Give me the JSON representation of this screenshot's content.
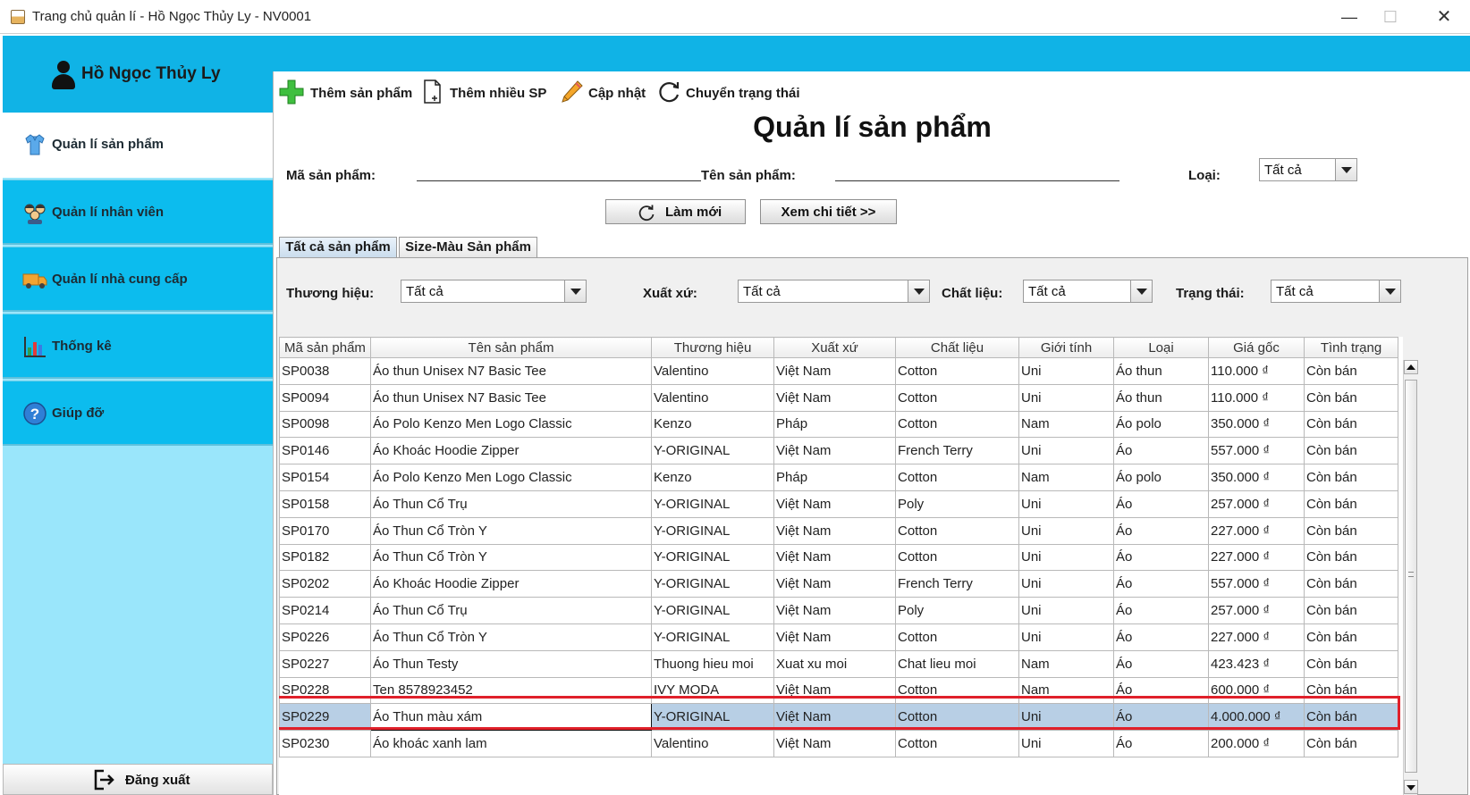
{
  "window": {
    "title": "Trang chủ quản lí - Hồ Ngọc Thủy Ly - NV0001",
    "minimize": "—",
    "maximize": "☐",
    "close": "✕"
  },
  "sidebar": {
    "user_name": "Hồ Ngọc Thủy Ly",
    "items": [
      {
        "label": "Quản lí sản phẩm",
        "icon": "shirt-icon",
        "active": true
      },
      {
        "label": "Quản lí nhân viên",
        "icon": "staff-icon",
        "active": false
      },
      {
        "label": "Quản lí nhà cung cấp",
        "icon": "truck-icon",
        "active": false
      },
      {
        "label": "Thống kê",
        "icon": "bar-chart-icon",
        "active": false
      },
      {
        "label": "Giúp đỡ",
        "icon": "help-icon",
        "active": false
      }
    ],
    "logout_label": "Đăng xuất"
  },
  "toolbar": {
    "add": "Thêm sản phẩm",
    "add_many": "Thêm nhiều SP",
    "update": "Cập nhật",
    "change_status": "Chuyển trạng thái"
  },
  "page_title": "Quản lí sản phẩm",
  "search": {
    "code_label": "Mã sản phẩm:",
    "code_value": "",
    "name_label": "Tên sản phẩm:",
    "name_value": "",
    "type_label": "Loại:",
    "type_value": "Tất cả"
  },
  "buttons": {
    "refresh": "Làm mới",
    "detail": "Xem chi tiết >>"
  },
  "tabs": [
    {
      "label": "Tất cả sản phẩm",
      "active": true
    },
    {
      "label": "Size-Màu Sản phẩm",
      "active": false
    }
  ],
  "filters": {
    "brand_label": "Thương hiệu:",
    "brand_value": "Tất cả",
    "origin_label": "Xuất xứ:",
    "origin_value": "Tất cả",
    "material_label": "Chất liệu:",
    "material_value": "Tất cả",
    "status_label": "Trạng thái:",
    "status_value": "Tất cả"
  },
  "table": {
    "columns": [
      "Mã sản phẩm",
      "Tên sản phẩm",
      "Thương hiệu",
      "Xuất xứ",
      "Chất liệu",
      "Giới tính",
      "Loại",
      "Giá gốc",
      "Tình trạng"
    ],
    "rows": [
      [
        "SP0038",
        "Áo thun Unisex N7 Basic Tee",
        "Valentino",
        "Việt Nam",
        "Cotton",
        "Uni",
        "Áo thun",
        "110.000 ₫",
        "Còn bán"
      ],
      [
        "SP0094",
        "Áo thun Unisex N7 Basic Tee",
        "Valentino",
        "Việt Nam",
        "Cotton",
        "Uni",
        "Áo thun",
        "110.000 ₫",
        "Còn bán"
      ],
      [
        "SP0098",
        "Áo Polo Kenzo Men Logo Classic",
        "Kenzo",
        "Pháp",
        "Cotton",
        "Nam",
        "Áo polo",
        "350.000 ₫",
        "Còn bán"
      ],
      [
        "SP0146",
        "Áo Khoác Hoodie Zipper",
        "Y-ORIGINAL",
        "Việt Nam",
        "French Terry",
        "Uni",
        "Áo",
        "557.000 ₫",
        "Còn bán"
      ],
      [
        "SP0154",
        "Áo Polo Kenzo Men Logo Classic",
        "Kenzo",
        "Pháp",
        "Cotton",
        "Nam",
        "Áo polo",
        "350.000 ₫",
        "Còn bán"
      ],
      [
        "SP0158",
        "Áo Thun Cổ Trụ",
        "Y-ORIGINAL",
        "Việt Nam",
        "Poly",
        "Uni",
        "Áo",
        "257.000 ₫",
        "Còn bán"
      ],
      [
        "SP0170",
        "Áo Thun Cổ Tròn Y",
        "Y-ORIGINAL",
        "Việt Nam",
        "Cotton",
        "Uni",
        "Áo",
        "227.000 ₫",
        "Còn bán"
      ],
      [
        "SP0182",
        "Áo Thun Cổ Tròn Y",
        "Y-ORIGINAL",
        "Việt Nam",
        "Cotton",
        "Uni",
        "Áo",
        "227.000 ₫",
        "Còn bán"
      ],
      [
        "SP0202",
        "Áo Khoác Hoodie Zipper",
        "Y-ORIGINAL",
        "Việt Nam",
        "French Terry",
        "Uni",
        "Áo",
        "557.000 ₫",
        "Còn bán"
      ],
      [
        "SP0214",
        "Áo Thun Cổ Trụ",
        "Y-ORIGINAL",
        "Việt Nam",
        "Poly",
        "Uni",
        "Áo",
        "257.000 ₫",
        "Còn bán"
      ],
      [
        "SP0226",
        "Áo Thun Cổ Tròn Y",
        "Y-ORIGINAL",
        "Việt Nam",
        "Cotton",
        "Uni",
        "Áo",
        "227.000 ₫",
        "Còn bán"
      ],
      [
        "SP0227",
        "Áo Thun Testy",
        "Thuong hieu moi",
        "Xuat xu moi",
        "Chat lieu moi",
        "Nam",
        "Áo",
        "423.423 ₫",
        "Còn bán"
      ],
      [
        "SP0228",
        "Ten 8578923452",
        "IVY MODA",
        "Việt Nam",
        "Cotton",
        "Nam",
        "Áo",
        "600.000 ₫",
        "Còn bán"
      ],
      [
        "SP0229",
        "Áo Thun màu xám",
        "Y-ORIGINAL",
        "Việt Nam",
        "Cotton",
        "Uni",
        "Áo",
        "4.000.000 ₫",
        "Còn bán"
      ],
      [
        "SP0230",
        "Áo khoác xanh lam",
        "Valentino",
        "Việt Nam",
        "Cotton",
        "Uni",
        "Áo",
        "200.000 ₫",
        "Còn bán"
      ]
    ],
    "selected_row": 13
  },
  "colors": {
    "accent": "#10b3e6",
    "sidebar_item": "#0cbcee",
    "sidebar_bg": "#9ae6fb",
    "selection": "#b8cfe5",
    "highlight_border": "#e0202a"
  }
}
